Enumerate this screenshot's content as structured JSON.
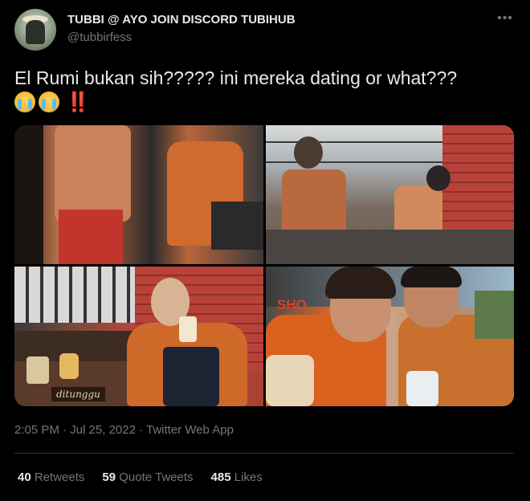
{
  "author": {
    "display_name": "TUBBI @ AYO JOIN DISCORD TUBIHUB",
    "username": "@tubbirfess"
  },
  "tweet": {
    "text": "El Rumi bukan sih????? ini mereka dating or what???",
    "emojis": [
      "crying-face",
      "crying-face",
      "double-exclamation"
    ],
    "bang": "‼️"
  },
  "media": {
    "photos": [
      {
        "id": "photo-1"
      },
      {
        "id": "photo-2"
      },
      {
        "id": "photo-3",
        "caption": "ditunggu"
      },
      {
        "id": "photo-4",
        "sign": "SHO"
      }
    ]
  },
  "meta": {
    "timestamp": "2:05 PM · Jul 25, 2022 · Twitter Web App"
  },
  "stats": {
    "retweets_count": "40",
    "retweets_label": "Retweets",
    "quotes_count": "59",
    "quotes_label": "Quote Tweets",
    "likes_count": "485",
    "likes_label": "Likes"
  },
  "colors": {
    "background": "#000000",
    "text_primary": "#e7e9ea",
    "text_secondary": "#71767b",
    "divider": "#2f3336"
  }
}
